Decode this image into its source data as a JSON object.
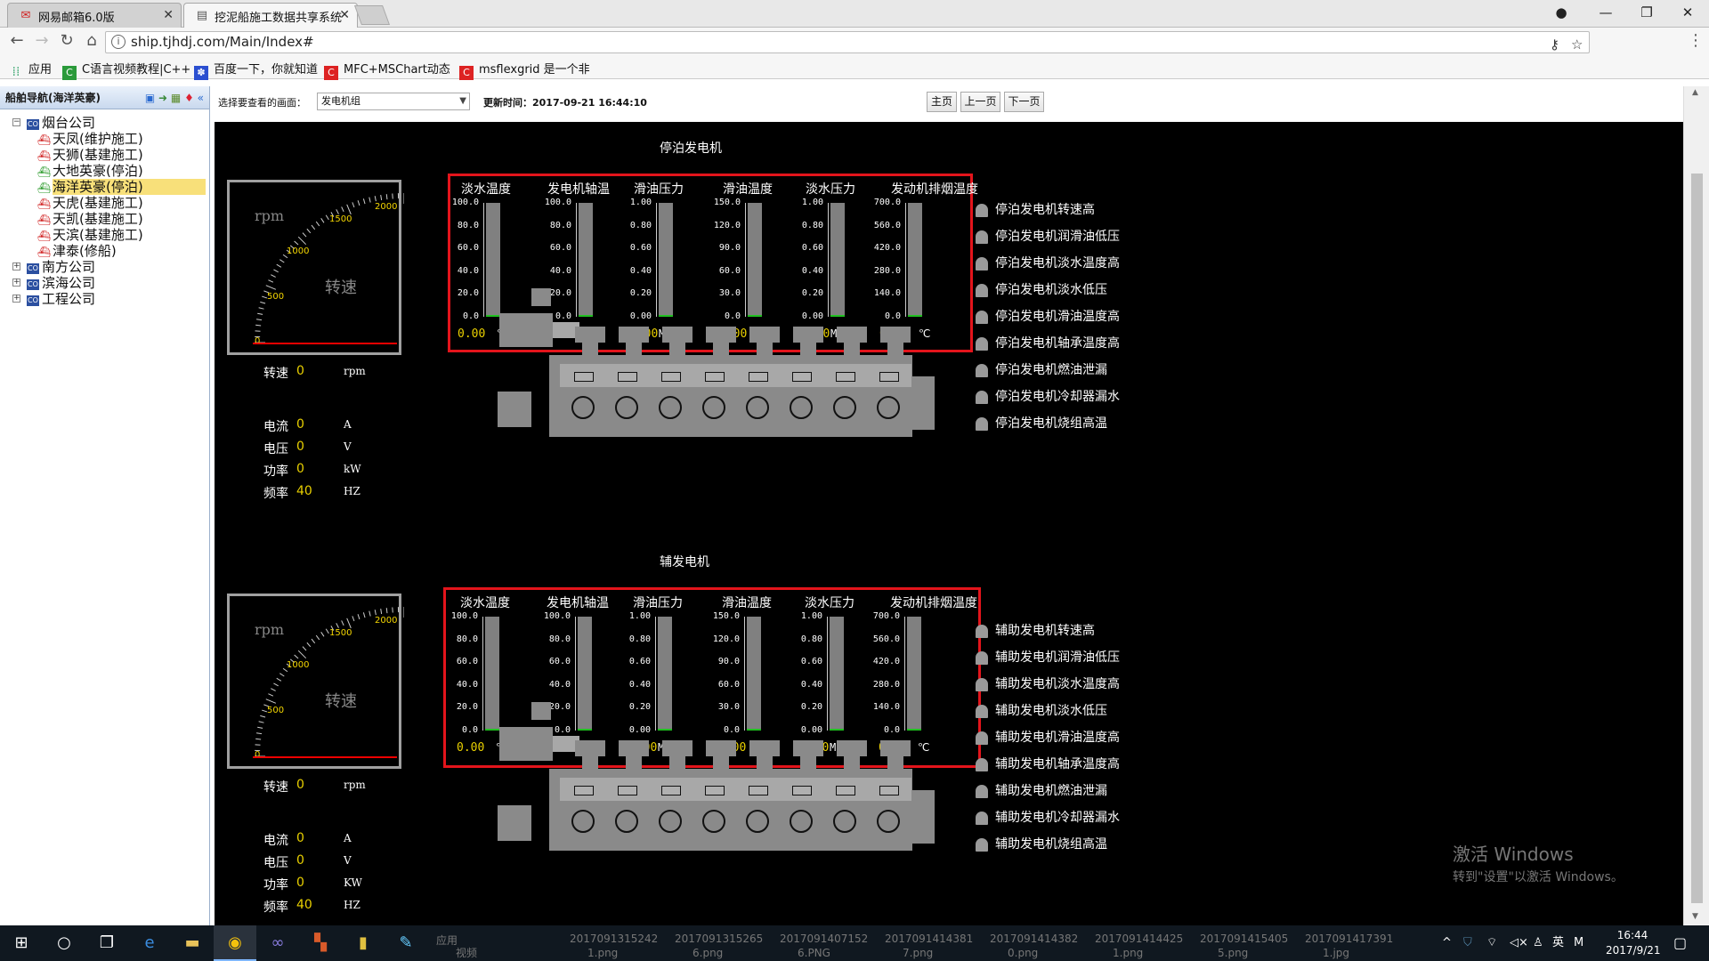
{
  "browser": {
    "tabs": [
      {
        "title": "网易邮箱6.0版",
        "icon": "mail-icon"
      },
      {
        "title": "挖泥船施工数据共享系统",
        "icon": "page-icon"
      }
    ],
    "url": "ship.tjhdj.com/Main/Index#",
    "bookmarks": [
      "应用",
      "C语言视频教程|C++",
      "百度一下，你就知道",
      "MFC+MSChart动态",
      "msflexgrid 是一个非"
    ]
  },
  "sidebar": {
    "title": "船舶导航(海洋英豪)",
    "companies": [
      {
        "name": "烟台公司",
        "expanded": true,
        "ships": [
          {
            "name": "天凤(维护施工)",
            "selected": false
          },
          {
            "name": "天狮(基建施工)",
            "selected": false
          },
          {
            "name": "大地英豪(停泊)",
            "selected": false
          },
          {
            "name": "海洋英豪(停泊)",
            "selected": true
          },
          {
            "name": "天虎(基建施工)",
            "selected": false
          },
          {
            "name": "天凯(基建施工)",
            "selected": false
          },
          {
            "name": "天滨(基建施工)",
            "selected": false
          },
          {
            "name": "津泰(修船)",
            "selected": false
          }
        ]
      },
      {
        "name": "南方公司",
        "expanded": false,
        "ships": []
      },
      {
        "name": "滨海公司",
        "expanded": false,
        "ships": []
      },
      {
        "name": "工程公司",
        "expanded": false,
        "ships": []
      }
    ]
  },
  "topbar": {
    "select_label": "选择要查看的画面：",
    "select_value": "发电机组",
    "update_label": "更新时间：2017-09-21 16:44:10",
    "buttons": {
      "home": "主页",
      "prev": "上一页",
      "next": "下一页"
    }
  },
  "sections": [
    {
      "title": "停泊发电机",
      "gauge": {
        "unit": "rpm",
        "name": "转速",
        "scale": [
          "0",
          "500",
          "1000",
          "1500",
          "2000"
        ]
      },
      "readouts": [
        {
          "label": "转速",
          "value": "0",
          "unit": "rpm"
        },
        {
          "label": "电流",
          "value": "0",
          "unit": "A"
        },
        {
          "label": "电压",
          "value": "0",
          "unit": "V"
        },
        {
          "label": "功率",
          "value": "0",
          "unit": "kW"
        },
        {
          "label": "频率",
          "value": "40",
          "unit": "HZ"
        }
      ],
      "meters": [
        {
          "label": "淡水温度",
          "ticks": [
            "100.0",
            "80.0",
            "60.0",
            "40.0",
            "20.0",
            "0.0"
          ],
          "value": "0.00",
          "unit": "℃"
        },
        {
          "label": "发电机轴温",
          "ticks": [
            "100.0",
            "80.0",
            "60.0",
            "40.0",
            "20.0",
            "0.0"
          ],
          "value": "0.00",
          "unit": "℃"
        },
        {
          "label": "滑油压力",
          "ticks": [
            "1.00",
            "0.80",
            "0.60",
            "0.40",
            "0.20",
            "0.00"
          ],
          "value": "0.00",
          "unit": "MPa"
        },
        {
          "label": "滑油温度",
          "ticks": [
            "150.0",
            "120.0",
            "90.0",
            "60.0",
            "30.0",
            "0.0"
          ],
          "value": "0.00",
          "unit": "℃"
        },
        {
          "label": "淡水压力",
          "ticks": [
            "1.00",
            "0.80",
            "0.60",
            "0.40",
            "0.20",
            "0.00"
          ],
          "value": "0.00",
          "unit": "MPa"
        },
        {
          "label": "发动机排烟温度",
          "ticks": [
            "700.0",
            "560.0",
            "420.0",
            "280.0",
            "140.0",
            "0.0"
          ],
          "value": "0.00",
          "unit": "℃"
        }
      ],
      "alarms": [
        "停泊发电机转速高",
        "停泊发电机润滑油低压",
        "停泊发电机淡水温度高",
        "停泊发电机淡水低压",
        "停泊发电机滑油温度高",
        "停泊发电机轴承温度高",
        "停泊发电机燃油泄漏",
        "停泊发电机冷却器漏水",
        "停泊发电机烧组高温"
      ]
    },
    {
      "title": "辅发电机",
      "gauge": {
        "unit": "rpm",
        "name": "转速",
        "scale": [
          "0",
          "500",
          "1000",
          "1500",
          "2000"
        ]
      },
      "readouts": [
        {
          "label": "转速",
          "value": "0",
          "unit": "rpm"
        },
        {
          "label": "电流",
          "value": "0",
          "unit": "A"
        },
        {
          "label": "电压",
          "value": "0",
          "unit": "V"
        },
        {
          "label": "功率",
          "value": "0",
          "unit": "KW"
        },
        {
          "label": "频率",
          "value": "40",
          "unit": "HZ"
        }
      ],
      "meters": [
        {
          "label": "淡水温度",
          "ticks": [
            "100.0",
            "80.0",
            "60.0",
            "40.0",
            "20.0",
            "0.0"
          ],
          "value": "0.00",
          "unit": "℃"
        },
        {
          "label": "发电机轴温",
          "ticks": [
            "100.0",
            "80.0",
            "60.0",
            "40.0",
            "20.0",
            "0.0"
          ],
          "value": "0.00",
          "unit": "℃"
        },
        {
          "label": "滑油压力",
          "ticks": [
            "1.00",
            "0.80",
            "0.60",
            "0.40",
            "0.20",
            "0.00"
          ],
          "value": "0.00",
          "unit": "MPa"
        },
        {
          "label": "滑油温度",
          "ticks": [
            "150.0",
            "120.0",
            "90.0",
            "60.0",
            "30.0",
            "0.0"
          ],
          "value": "0.00",
          "unit": "℃"
        },
        {
          "label": "淡水压力",
          "ticks": [
            "1.00",
            "0.80",
            "0.60",
            "0.40",
            "0.20",
            "0.00"
          ],
          "value": "0.00",
          "unit": "MPa"
        },
        {
          "label": "发动机排烟温度",
          "ticks": [
            "700.0",
            "560.0",
            "420.0",
            "280.0",
            "140.0",
            "0.0"
          ],
          "value": "0.00",
          "unit": "℃"
        }
      ],
      "alarms": [
        "辅助发电机转速高",
        "辅助发电机润滑油低压",
        "辅助发电机淡水温度高",
        "辅助发电机淡水低压",
        "辅助发电机滑油温度高",
        "辅助发电机轴承温度高",
        "辅助发电机燃油泄漏",
        "辅助发电机冷却器漏水",
        "辅助发电机烧组高温"
      ]
    }
  ],
  "watermark": {
    "line1": "激活 Windows",
    "line2": "转到\"设置\"以激活 Windows。"
  },
  "taskbar": {
    "ghost_files": [
      "2017091315242",
      "2017091315265",
      "2017091407152",
      "2017091414381",
      "2017091414382",
      "2017091414425",
      "2017091415405",
      "2017091417391"
    ],
    "ghost_files_ext": [
      "1.png",
      "6.png",
      "6.PNG",
      "7.png",
      "0.png",
      "1.png",
      "5.png",
      "1.jpg"
    ],
    "ghost_left": [
      "应用",
      "视频"
    ],
    "ime": "英",
    "clock_time": "16:44",
    "clock_date": "2017/9/21"
  },
  "colors": {
    "panel_border": "#e3141b",
    "value_yellow": "#e9d000",
    "scada_bg": "#000000",
    "selected_node": "#f8e07a"
  }
}
